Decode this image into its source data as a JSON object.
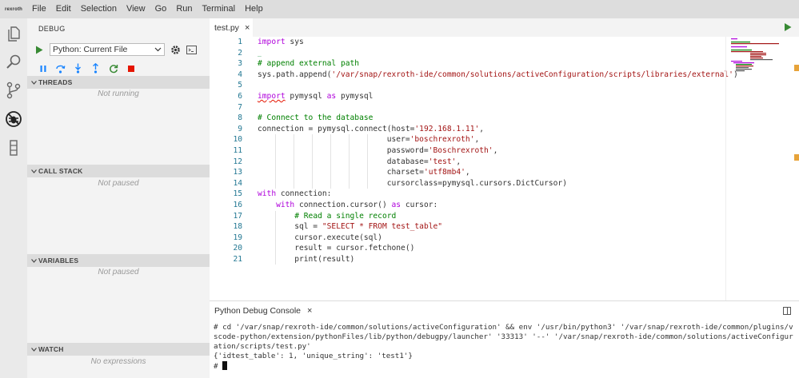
{
  "logo_text": "rexroth",
  "menu": [
    "File",
    "Edit",
    "Selection",
    "View",
    "Go",
    "Run",
    "Terminal",
    "Help"
  ],
  "activity_icons": [
    "files-icon",
    "search-icon",
    "source-control-icon",
    "debug-icon",
    "extensions-icon"
  ],
  "sidebar": {
    "title": "DEBUG",
    "config_selected": "Python: Current File",
    "sections": [
      {
        "label": "THREADS",
        "empty": "Not running"
      },
      {
        "label": "CALL STACK",
        "empty": "Not paused"
      },
      {
        "label": "VARIABLES",
        "empty": "Not paused"
      },
      {
        "label": "WATCH",
        "empty": "No expressions"
      }
    ]
  },
  "editor": {
    "tab_label": "test.py",
    "tab_close": "×",
    "line_numbers": [
      "1",
      "2",
      "3",
      "4",
      "5",
      "6",
      "7",
      "8",
      "9",
      "10",
      "11",
      "12",
      "13",
      "14",
      "15",
      "16",
      "17",
      "18",
      "19",
      "20",
      "21"
    ]
  },
  "panel": {
    "tab_label": "Python Debug Console",
    "tab_close": "×",
    "output": "# cd '/var/snap/rexroth-ide/common/solutions/activeConfiguration' && env '/usr/bin/python3' '/var/snap/rexroth-ide/common/plugins/vscode-python/extension/pythonFiles/lib/python/debugpy/launcher' '33313' '--' '/var/snap/rexroth-ide/common/solutions/activeConfiguration/scripts/test.py'\n{'idtest_table': 1, 'unique_string': 'test1'}",
    "prompt": "# "
  },
  "colors": {
    "keyword": "#af00db",
    "string": "#a31515",
    "comment": "#008000",
    "run_green": "#388a34",
    "stop_red": "#e51400"
  }
}
